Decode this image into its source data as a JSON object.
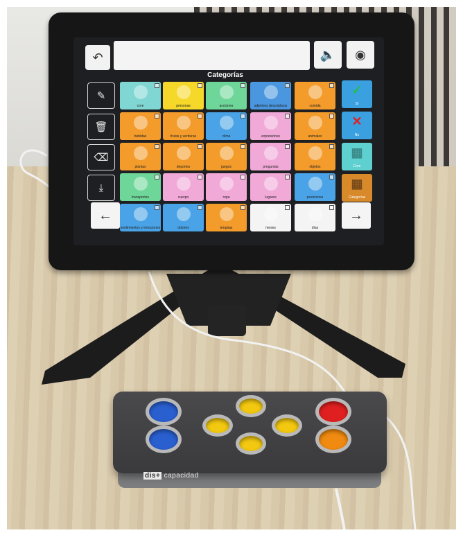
{
  "screen": {
    "title": "Categorías",
    "topbar": {
      "back_icon": "undo-arrow-icon",
      "speak_icon": "speaker-icon",
      "view_icon": "eye-icon"
    },
    "side_actions": [
      "edit-icon",
      "trash-icon",
      "backspace-icon",
      "download-icon"
    ],
    "grid": [
      {
        "label": "core",
        "color": "#7fd6d3"
      },
      {
        "label": "personas",
        "color": "#f6d82a"
      },
      {
        "label": "acciones",
        "color": "#6fd69a"
      },
      {
        "label": "adjetivos descriptivos",
        "color": "#4a97e0"
      },
      {
        "label": "comida",
        "color": "#f39c2b"
      },
      {
        "label": "bebidas",
        "color": "#f39c2b"
      },
      {
        "label": "frutas y verduras",
        "color": "#f39c2b"
      },
      {
        "label": "clima",
        "color": "#4aa3e6"
      },
      {
        "label": "expresiones",
        "color": "#f1a9d8"
      },
      {
        "label": "animales",
        "color": "#f39c2b"
      },
      {
        "label": "plantas",
        "color": "#f39c2b"
      },
      {
        "label": "deportes",
        "color": "#f39c2b"
      },
      {
        "label": "juegos",
        "color": "#f39c2b"
      },
      {
        "label": "preguntas",
        "color": "#f1a9d8"
      },
      {
        "label": "objetos",
        "color": "#f39c2b"
      },
      {
        "label": "transportes",
        "color": "#6fd69a"
      },
      {
        "label": "cuerpo",
        "color": "#f1a9d8"
      },
      {
        "label": "ropa",
        "color": "#f1a9d8"
      },
      {
        "label": "lugares",
        "color": "#f1a9d8"
      },
      {
        "label": "posiciones",
        "color": "#4aa3e6"
      },
      {
        "label": "sentimientos y emociones",
        "color": "#4aa3e6"
      },
      {
        "label": "dolores",
        "color": "#4aa3e6"
      },
      {
        "label": "terapias",
        "color": "#f39c2b"
      },
      {
        "label": "meses",
        "color": "#f4f4f4"
      },
      {
        "label": "días",
        "color": "#f4f4f4"
      }
    ],
    "right_column": [
      {
        "label": "Sí",
        "icon": "✓",
        "color": "#3aa0e0",
        "icon_color": "#22c04a"
      },
      {
        "label": "No",
        "icon": "✕",
        "color": "#3aa0e0",
        "icon_color": "#e02020"
      },
      {
        "label": "Core",
        "icon": "▦",
        "color": "#5fd0d0",
        "icon_color": "#3a8a8a"
      },
      {
        "label": "Categorías",
        "icon": "▦",
        "color": "#d88a2a",
        "icon_color": "#7a4a1a"
      }
    ],
    "nav": {
      "prev_icon": "←",
      "next_icon": "→"
    }
  },
  "controller": {
    "brand_prefix": "dis+",
    "brand_name": "capacidad",
    "buttons": [
      {
        "name": "blue-left-top",
        "color": "#2a5fd0"
      },
      {
        "name": "blue-left-bottom",
        "color": "#2a5fd0"
      },
      {
        "name": "yellow-top",
        "color": "#f2c810"
      },
      {
        "name": "yellow-left",
        "color": "#f2c810"
      },
      {
        "name": "yellow-right",
        "color": "#f2c810"
      },
      {
        "name": "yellow-bottom",
        "color": "#f2c810"
      },
      {
        "name": "red-right-top",
        "color": "#e02020"
      },
      {
        "name": "orange-right-bottom",
        "color": "#f08a10"
      }
    ]
  }
}
